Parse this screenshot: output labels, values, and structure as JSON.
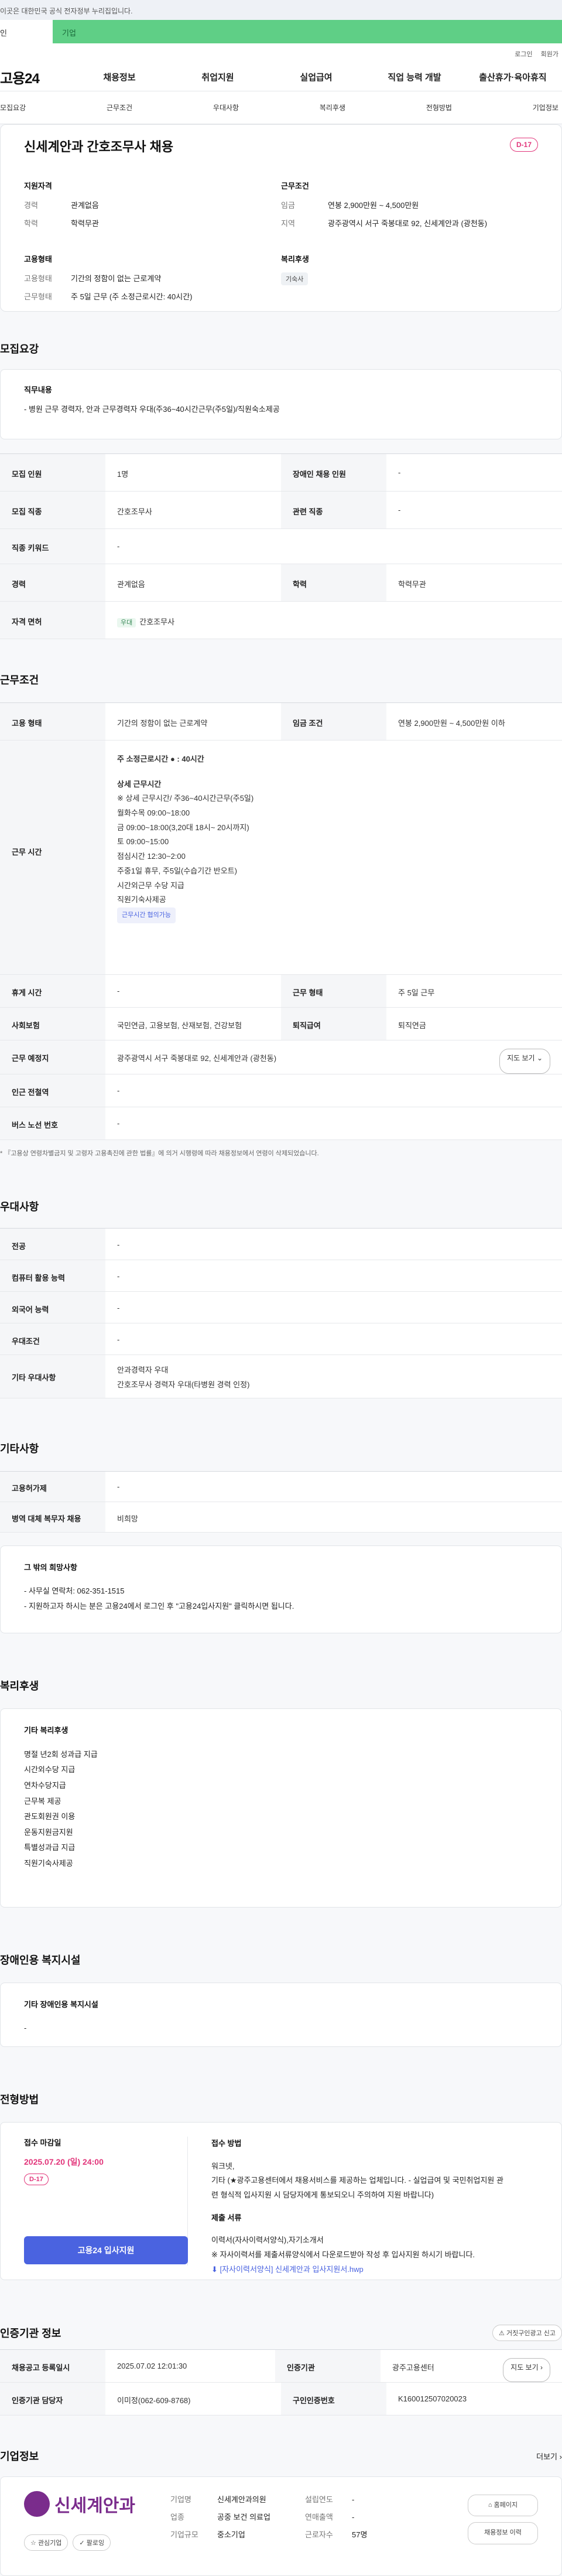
{
  "topbar": {
    "notice": "이곳은 대한민국 공식 전자정부 누리집입니다."
  },
  "tabs": {
    "personal": "인",
    "company": "기업"
  },
  "util": {
    "login": "로그인",
    "join": "회원가"
  },
  "gnb": {
    "logo": "고용24",
    "items": [
      "채용정보",
      "취업지원",
      "실업급여",
      "직업 능력 개발",
      "출산휴가·육아휴직"
    ]
  },
  "anchor": {
    "items": [
      "모집요강",
      "근무조건",
      "우대사항",
      "복리후생",
      "전형방법",
      "기업정보"
    ]
  },
  "header": {
    "title": "신세계안과 간호조무사 채용",
    "dday": "D-17",
    "req_title": "지원자격",
    "career_k": "경력",
    "career_v": "관계없음",
    "edu_k": "학력",
    "edu_v": "학력무관",
    "cond_title": "근무조건",
    "pay_k": "임금",
    "pay_v": "연봉 2,900만원 ~ 4,500만원",
    "region_k": "지역",
    "region_v": "광주광역시 서구 죽봉대로 92, 신세계안과 (광천동)",
    "emp_title": "고용형태",
    "emp_k": "고용형태",
    "emp_v": "기간의 정함이 없는 근로계약",
    "work_k": "근무형태",
    "work_v": "주 5일 근무 (주 소정근로시간: 40시간)",
    "welfare_title": "복리후생",
    "welfare_tag": "기숙사"
  },
  "recruit": {
    "title": "모집요강",
    "duty_title": "직무내용",
    "duty_text": "- 병원 근무 경력자, 안과 근무경력자 우대(주36~40시간근무(주5일)/직원숙소제공",
    "rows": [
      {
        "k1": "모집 인원",
        "v1": "1명",
        "k2": "장애인 채용 인원",
        "v2": "-"
      },
      {
        "k1": "모집 직종",
        "v1": "간호조무사",
        "k2": "관련 직종",
        "v2": "-"
      },
      {
        "k1": "직종 키워드",
        "v1": "-",
        "k2": "",
        "v2": ""
      },
      {
        "k1": "경력",
        "v1": "관계없음",
        "k2": "학력",
        "v2": "학력무관"
      }
    ],
    "license_k": "자격 면허",
    "license_tag": "우대",
    "license_v": "간호조무사"
  },
  "conditions": {
    "title": "근무조건",
    "emp_k": "고용 형태",
    "emp_v": "기간의 정함이 없는 근로계약",
    "pay_k": "임금 조건",
    "pay_v": "연봉 2,900만원 ~ 4,500만원 이하",
    "time_k": "근무 시간",
    "time_head": "주 소정근로시간 ● : 40시간",
    "time_lines": [
      "상세 근무시간",
      "※ 상세 근무시간/ 주36~40시간근무(주5일)",
      "월화수목 09:00~18:00",
      "금 09:00~18:00(3,20대 18시~ 20시까지)",
      "토 09:00~15:00",
      "점심시간 12:30~2:00",
      "주중1일 휴무, 주5일(수습기간 반오트)",
      "시간외근무 수당 지급",
      "직원기숙사제공"
    ],
    "time_tag": "근무시간 협의가능",
    "rest_k": "휴게 시간",
    "rest_v": "-",
    "shape_k": "근무 형태",
    "shape_v": "주 5일 근무",
    "ins_k": "사회보험",
    "ins_v": "국민연금, 고용보험, 산재보험, 건강보험",
    "retire_k": "퇴직급여",
    "retire_v": "퇴직연금",
    "place_k": "근무 예정지",
    "place_v": "광주광역시 서구 죽봉대로 92, 신세계안과 (광천동)",
    "map_btn": "지도 보기",
    "subway_k": "인근 전철역",
    "subway_v": "-",
    "bus_k": "버스 노선 번호",
    "bus_v": "-",
    "note": "* 『고용상 연령차별금지 및 고령자 고용촉진에 관한 법률』에 의거 시행령에 따라 채용정보에서 연령이 삭제되었습니다."
  },
  "prefer": {
    "title": "우대사항",
    "rows": [
      {
        "k": "전공",
        "v": "-"
      },
      {
        "k": "컴퓨터 활용 능력",
        "v": "-"
      },
      {
        "k": "외국어 능력",
        "v": "-"
      },
      {
        "k": "우대조건",
        "v": "-"
      }
    ],
    "etc_k": "기타 우대사항",
    "etc_v1": "안과경력자 우대",
    "etc_v2": "간호조무사 경력자 우대(타병원 경력 인정)"
  },
  "others": {
    "title": "기타사항",
    "rows": [
      {
        "k": "고용허가제",
        "v": "-"
      },
      {
        "k": "병역 대체 복무자 채용",
        "v": "비희망"
      }
    ],
    "other_title": "그 밖의 희망사항",
    "other_l1": "- 사무실 연락처: 062-351-1515",
    "other_l2": "- 지원하고자 하시는 분은 고용24에서 로그인 후 \"고용24입사지원\" 클릭하시면 됩니다."
  },
  "welfare": {
    "title": "복리후생",
    "box_title": "기타 복리후생",
    "items": [
      "명절 년2회 성과급 지급",
      "시간외수당 지급",
      "연차수당지급",
      "근무복 제공",
      "관도회원권 이용",
      "운동지원금지원",
      "특별성과급 지급",
      "직원기숙사제공"
    ]
  },
  "disabled": {
    "title": "장애인용 복지시설",
    "box_title": "기타 장애인용 복지시설",
    "box_v": "-"
  },
  "selection": {
    "title": "전형방법",
    "deadline_title": "접수 마감일",
    "deadline": "2025.07.20 (일) 24:00",
    "dday": "D-17",
    "apply_btn": "고용24 입사지원",
    "method_title": "접수 방법",
    "method_l1": "워크넷,",
    "method_l2": "기타 (★광주고용센터에서 채용서비스를 제공하는 업체입니다. - 실업급여 및 국민취업지원 관",
    "method_l3": "련 형식적 입사지원 시 담당자에게 통보되오니 주의하여 지원 바랍니다)",
    "doc_title": "제출 서류",
    "doc_l1": "이력서(자사이력서양식),자기소개서",
    "doc_l2": "※ 자사이력서를 제출서류양식에서 다운로드받아 작성 후 입사지원 하시기 바랍니다.",
    "doc_link": "[자사이력서양식] 신세계안과 입사지원서.hwp"
  },
  "cert": {
    "title": "인증기관 정보",
    "report_btn": "거짓구인광고 신고",
    "reg_k": "채용공고 등록일시",
    "reg_v": "2025.07.02 12:01:30",
    "org_k": "인증기관",
    "org_v": "광주고용센터",
    "mgr_k": "인증기관 담당자",
    "mgr_v": "이미정(062-609-8768)",
    "no_k": "구인인증번호",
    "no_v": "K160012507020023",
    "map_btn": "지도 보기"
  },
  "company": {
    "title": "기업정보",
    "more": "더보기",
    "logo_text": "신세계안과",
    "fav_btn": "관심기업",
    "follow_btn": "팔로잉",
    "name_k": "기업명",
    "name_v": "신세계안과의원",
    "type_k": "업종",
    "type_v": "공중 보건 의료업",
    "size_k": "기업규모",
    "size_v": "중소기업",
    "year_k": "설립연도",
    "year_v": "-",
    "sales_k": "연매출액",
    "sales_v": "-",
    "emp_k": "근로자수",
    "emp_v": "57명",
    "home_btn": "홈페이지",
    "jobs_btn": "채용정보 이력"
  }
}
